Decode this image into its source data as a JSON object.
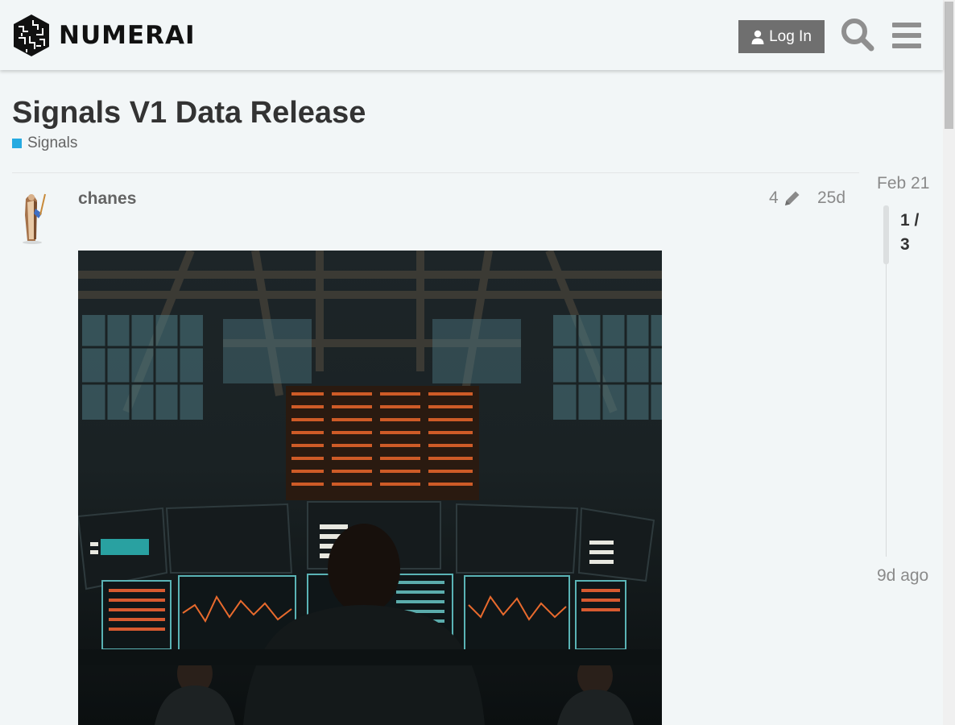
{
  "header": {
    "logo_text": "NUMERAI",
    "login_label": "Log In",
    "icons": [
      "logo-cube-icon",
      "user-icon",
      "search-icon",
      "hamburger-menu-icon"
    ]
  },
  "topic": {
    "title": "Signals V1 Data Release",
    "category": "Signals",
    "category_color": "#25aae1"
  },
  "post": {
    "author": "chanes",
    "edit_count": "4",
    "age": "25d",
    "icons": [
      "pencil-icon",
      "avatar"
    ],
    "image_description": "trading floor photo"
  },
  "timeline": {
    "start_date": "Feb 21",
    "position": "1 /",
    "total": "3",
    "end_label": "9d ago"
  },
  "colors": {
    "background": "#f2f6f7",
    "login_button": "#6f6f6f",
    "category": "#25aae1"
  }
}
